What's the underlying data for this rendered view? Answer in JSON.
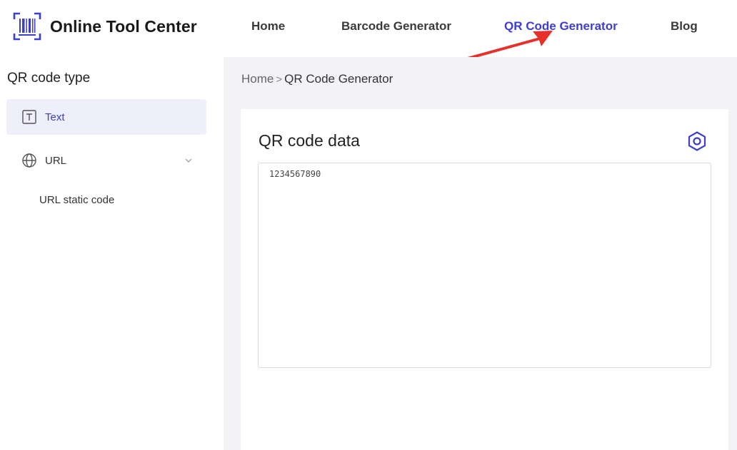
{
  "header": {
    "logo_text": "Online Tool Center",
    "nav": [
      {
        "label": "Home",
        "active": false
      },
      {
        "label": "Barcode Generator",
        "active": false
      },
      {
        "label": "QR Code Generator",
        "active": true
      },
      {
        "label": "Blog",
        "active": false
      }
    ]
  },
  "sidebar": {
    "title": "QR code type",
    "items": [
      {
        "label": "Text",
        "icon": "text-icon",
        "active": true
      },
      {
        "label": "URL",
        "icon": "globe-icon",
        "active": false,
        "expandable": true
      }
    ],
    "sub_items": [
      {
        "label": "URL static code"
      }
    ]
  },
  "main": {
    "breadcrumb": {
      "home": "Home",
      "separator": ">",
      "current": "QR Code Generator"
    },
    "card": {
      "title": "QR code data",
      "data_value": "1234567890"
    }
  },
  "colors": {
    "accent": "#3d3dd1",
    "arrow": "#e8302a",
    "main_bg": "#f2f2f7",
    "active_item_bg": "#efeffb"
  }
}
